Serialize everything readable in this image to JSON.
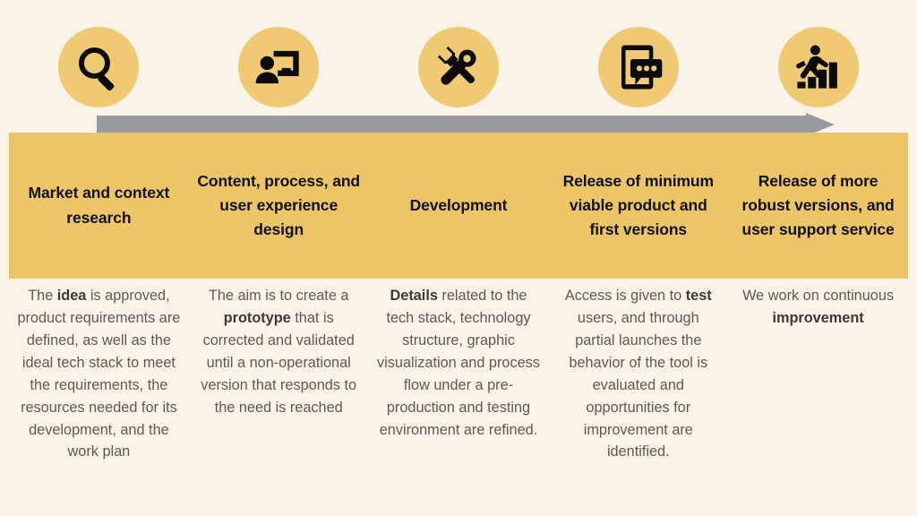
{
  "palette": {
    "background": "#faf3ea",
    "band_gold": "#ebc568",
    "circle_gold": "#efca72",
    "arrow_gray": "#9a9a9e",
    "title_text": "#111111",
    "body_text": "#5e5a52",
    "body_bold_text": "#3c3a36"
  },
  "arrow": {
    "name": "process-flow-arrow",
    "direction": "left-to-right"
  },
  "stages": [
    {
      "index": 1,
      "icon": "magnifying-glass-icon",
      "title": "Market and context research",
      "description_parts": [
        {
          "text": "The ",
          "bold": false
        },
        {
          "text": "idea",
          "bold": true
        },
        {
          "text": " is approved, product requirements are defined, as well as the ideal tech stack to meet the requirements, the resources needed for its development, and the work plan",
          "bold": false
        }
      ],
      "description": "The idea is approved, product requirements are defined, as well as the ideal tech stack to meet the requirements, the resources needed for its development, and the work plan"
    },
    {
      "index": 2,
      "icon": "person-presentation-icon",
      "title": "Content, process, and user experience design",
      "description_parts": [
        {
          "text": "The aim is to create a ",
          "bold": false
        },
        {
          "text": "prototype",
          "bold": true
        },
        {
          "text": " that is corrected and validated until a non-operational version that responds to the need is reached",
          "bold": false
        }
      ],
      "description": "The aim is to create a prototype that is corrected and validated until a non-operational version that responds to the need is reached"
    },
    {
      "index": 3,
      "icon": "wrench-screwdriver-tools-icon",
      "title": "Development",
      "description_parts": [
        {
          "text": "Details",
          "bold": true
        },
        {
          "text": " related to the tech stack, technology structure, graphic visualization and process flow under a pre-production and testing environment are refined.",
          "bold": false
        }
      ],
      "description": "Details related to the tech stack, technology structure, graphic visualization and process flow under a pre-production and testing environment are refined."
    },
    {
      "index": 4,
      "icon": "mobile-chat-bubble-icon",
      "title": "Release of minimum viable product and first versions",
      "description_parts": [
        {
          "text": "Access is given to ",
          "bold": false
        },
        {
          "text": "test",
          "bold": true
        },
        {
          "text": " users, and through partial launches the behavior of the tool is evaluated and opportunities for improvement are identified.",
          "bold": false
        }
      ],
      "description": "Access is given to test users, and through partial launches the behavior of the tool is evaluated and opportunities for improvement are identified."
    },
    {
      "index": 5,
      "icon": "person-running-up-bar-chart-icon",
      "title": "Release of more robust versions, and user support service",
      "description_parts": [
        {
          "text": "We work on continuous ",
          "bold": false
        },
        {
          "text": "improvement",
          "bold": true
        }
      ],
      "description": "We work on continuous improvement"
    }
  ]
}
